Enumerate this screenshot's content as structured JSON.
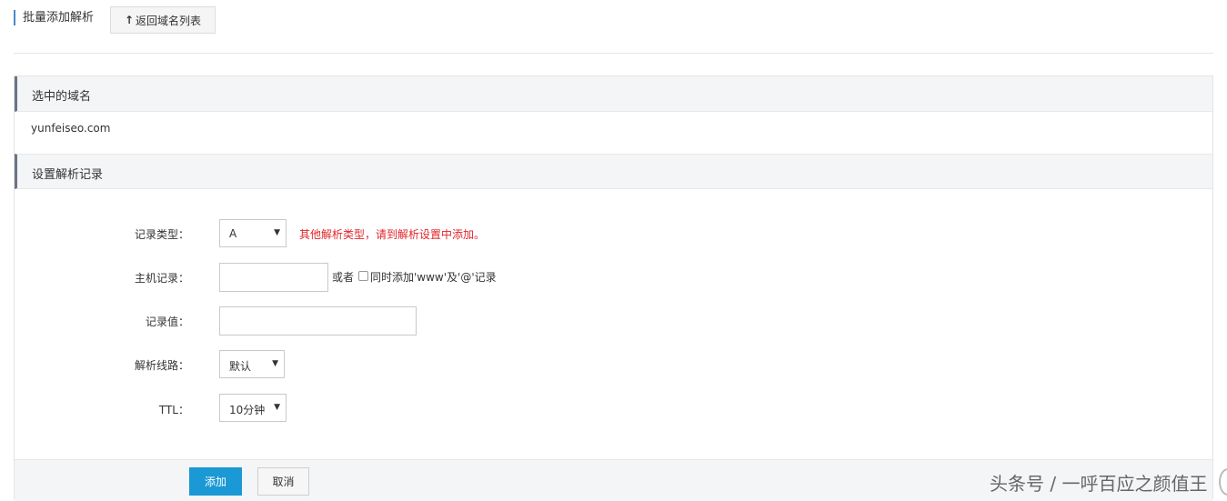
{
  "header": {
    "title": "批量添加解析",
    "back_label": "返回域名列表"
  },
  "selected_domain": {
    "section_title": "选中的域名",
    "value": "yunfeiseo.com"
  },
  "record_settings": {
    "section_title": "设置解析记录",
    "record_type": {
      "label": "记录类型：",
      "value": "A",
      "hint": "其他解析类型，请到解析设置中添加。"
    },
    "host_record": {
      "label": "主机记录：",
      "value": "",
      "or_label": "或者",
      "checkbox_label": "同时添加'www'及'@'记录",
      "checked": false
    },
    "record_value": {
      "label": "记录值：",
      "value": ""
    },
    "line": {
      "label": "解析线路：",
      "value": "默认"
    },
    "ttl": {
      "label": "TTL：",
      "value": "10分钟"
    }
  },
  "footer": {
    "add_label": "添加",
    "cancel_label": "取消"
  },
  "watermark": "头条号 / 一呼百应之颜值王",
  "colors": {
    "primary_button": "#1a99d4",
    "hint_red": "#e0262a",
    "section_bar": "#6b7387"
  }
}
